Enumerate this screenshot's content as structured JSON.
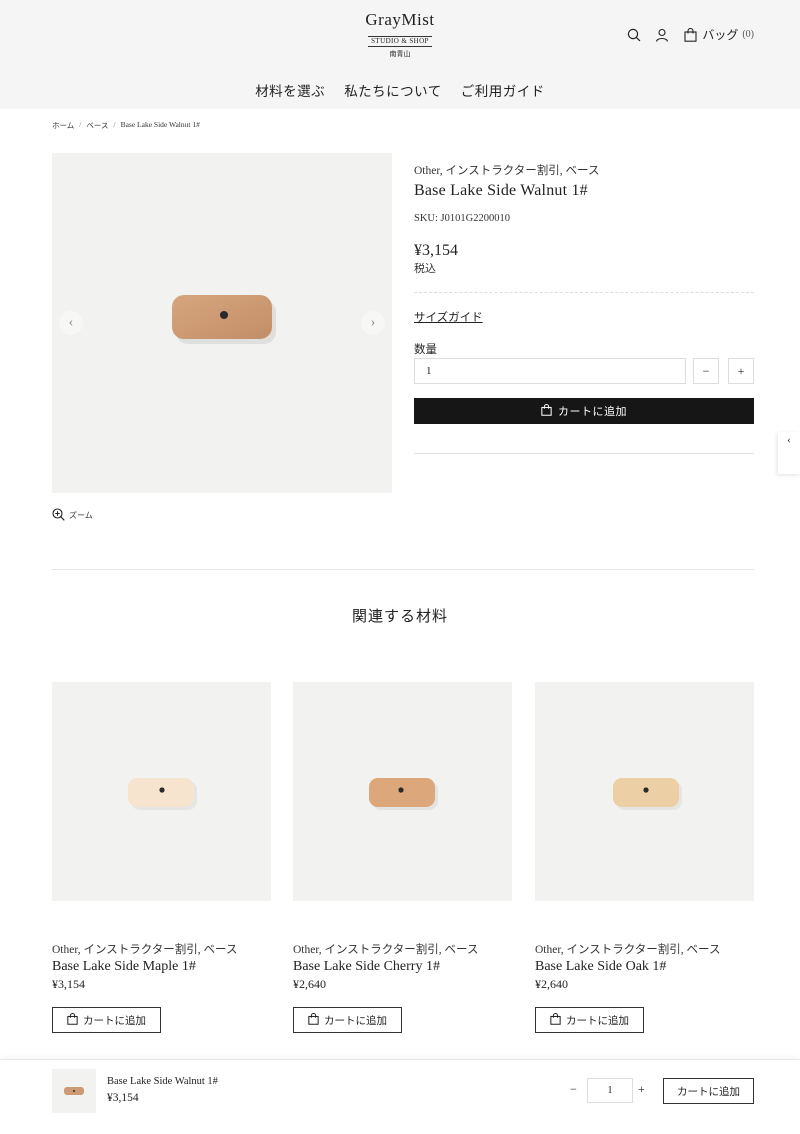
{
  "header": {
    "logo_title": "GrayMist",
    "logo_sub": "STUDIO & SHOP",
    "logo_loc": "南青山",
    "icons": [
      "search-icon",
      "user-icon",
      "bag-icon"
    ],
    "bag_label": "バッグ",
    "bag_count": "(0)"
  },
  "nav": {
    "items": [
      "材料を選ぶ",
      "私たちについて",
      "ご利用ガイド"
    ]
  },
  "breadcrumb": {
    "items": [
      "ホーム",
      "ベース",
      "Base Lake Side Walnut 1#"
    ],
    "separator": "/"
  },
  "gallery": {
    "prev_icon": "chevron-left-icon",
    "next_icon": "chevron-right-icon",
    "zoom_label": "ズーム",
    "product_color": "#cc9a74"
  },
  "product": {
    "categories": "Other, インストラクター割引, ベース",
    "title": "Base Lake Side Walnut 1#",
    "sku": "SKU: J0101G2200010",
    "price": "¥3,154",
    "tax": "税込",
    "size_guide": "サイズガイド",
    "qty_label": "数量",
    "qty_value": "1",
    "minus": "−",
    "plus": "+",
    "add_to_cart": "カートに追加"
  },
  "related": {
    "title": "関連する材料",
    "items": [
      {
        "categories": "Other, インストラクター割引, ベース",
        "title": "Base Lake Side Maple 1#",
        "price": "¥3,154",
        "button": "カートに追加",
        "color": "#f6e4cf"
      },
      {
        "categories": "Other, インストラクター割引, ベース",
        "title": "Base Lake Side Cherry 1#",
        "price": "¥2,640",
        "button": "カートに追加",
        "color": "#dca77a"
      },
      {
        "categories": "Other, インストラクター割引, ベース",
        "title": "Base Lake Side Oak 1#",
        "price": "¥2,640",
        "button": "カートに追加",
        "color": "#eccfa4"
      }
    ]
  },
  "sticky": {
    "name": "Base Lake Side Walnut 1#",
    "price": "¥3,154",
    "minus": "−",
    "qty": "1",
    "plus": "+",
    "add_to_cart": "カートに追加"
  },
  "side_tab": {
    "icon": "chevron-left-icon",
    "glyph": "‹"
  }
}
